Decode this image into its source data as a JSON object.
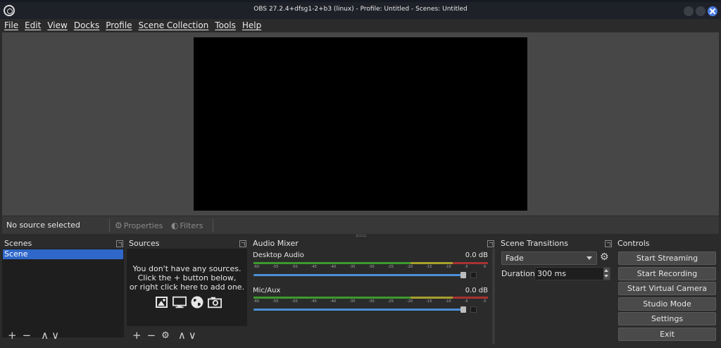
{
  "window": {
    "title": "OBS 27.2.4+dfsg1-2+b3 (linux) - Profile: Untitled - Scenes: Untitled"
  },
  "menu": [
    "File",
    "Edit",
    "View",
    "Docks",
    "Profile",
    "Scene Collection",
    "Tools",
    "Help"
  ],
  "context_bar": {
    "no_source": "No source selected",
    "properties": "Properties",
    "filters": "Filters"
  },
  "scenes": {
    "title": "Scenes",
    "items": [
      "Scene"
    ]
  },
  "sources": {
    "title": "Sources",
    "empty_line1": "You don't have any sources.",
    "empty_line2": "Click the + button below,",
    "empty_line3": "or right click here to add one."
  },
  "audio_mixer": {
    "title": "Audio Mixer",
    "tick_labels": [
      "-60",
      "-55",
      "-50",
      "-45",
      "-40",
      "-35",
      "-30",
      "-25",
      "-20",
      "-15",
      "-10",
      "-5",
      "0"
    ],
    "channels": [
      {
        "name": "Desktop Audio",
        "level": "0.0 dB",
        "volume": 1.0
      },
      {
        "name": "Mic/Aux",
        "level": "0.0 dB",
        "volume": 1.0
      }
    ]
  },
  "transitions": {
    "title": "Scene Transitions",
    "selected": "Fade",
    "duration_label": "Duration",
    "duration_value": "300 ms"
  },
  "controls": {
    "title": "Controls",
    "buttons": [
      "Start Streaming",
      "Start Recording",
      "Start Virtual Camera",
      "Studio Mode",
      "Settings",
      "Exit"
    ]
  },
  "colors": {
    "accent": "#2f68c9",
    "meter_green": "#3c9a2e",
    "meter_yellow": "#a8a02c",
    "meter_red": "#a83232",
    "slider_blue": "#4a90d9"
  }
}
